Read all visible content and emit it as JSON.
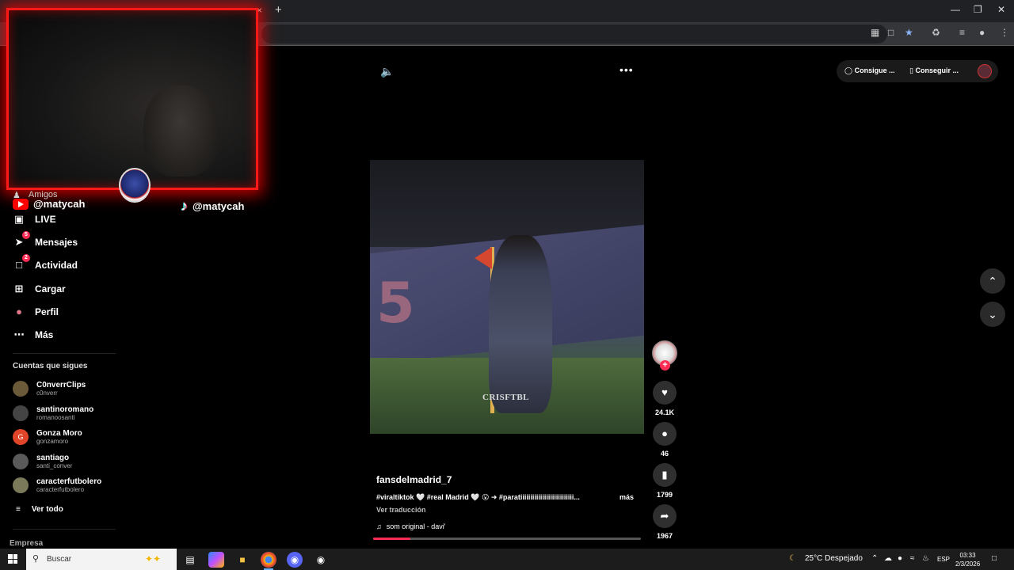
{
  "browser": {
    "tab_close": "×",
    "new_tab": "+"
  },
  "webcam": {
    "youtube_handle": "@matycah",
    "tiktok_handle": "@matycah"
  },
  "sidebar": {
    "amigos_label": "Amigos",
    "items": [
      {
        "label": "LIVE",
        "icon": "live-icon"
      },
      {
        "label": "Mensajes",
        "icon": "messages-icon",
        "badge": "5"
      },
      {
        "label": "Actividad",
        "icon": "activity-icon",
        "badge": "2"
      },
      {
        "label": "Cargar",
        "icon": "upload-icon"
      },
      {
        "label": "Perfil",
        "icon": "profile-icon"
      },
      {
        "label": "Más",
        "icon": "more-icon"
      }
    ],
    "following_title": "Cuentas que sigues",
    "accounts": [
      {
        "name": "C0nverrClips",
        "handle": "c0nverr"
      },
      {
        "name": "santinoromano",
        "handle": "romanoosanti"
      },
      {
        "name": "Gonza Moro",
        "handle": "gonzamoro",
        "initial": "G"
      },
      {
        "name": "santiago",
        "handle": "santi_conver"
      },
      {
        "name": "caracterfutbolero",
        "handle": "caracterfutbolero"
      }
    ],
    "see_all": "Ver todo",
    "company": "Empresa"
  },
  "video": {
    "watermark": "CRISFTBL",
    "big_number": "5",
    "author": "fansdelmadrid_7",
    "caption": "#viraltiktok 🤍 #real Madrid 🤍 😮 ➜ #parati​iiiiiiiiiiiiiiiiiiiiiiiiii...",
    "more": "más",
    "translate": "Ver traducción",
    "sound": "som original - davi'",
    "progress": 0.14
  },
  "actions": {
    "likes": "24.1K",
    "comments": "46",
    "saves": "1799",
    "shares": "1967"
  },
  "top_right": {
    "get_app_1": "Consigue ...",
    "get_app_2": "Conseguir ..."
  },
  "taskbar": {
    "search_placeholder": "Buscar",
    "weather": "25°C  Despejado",
    "language": "ESP",
    "time": "03:33",
    "date": "2/3/2026"
  },
  "colors": {
    "accent": "#fe2c55",
    "webcam_border": "#ff1a1a",
    "background": "#000000"
  }
}
